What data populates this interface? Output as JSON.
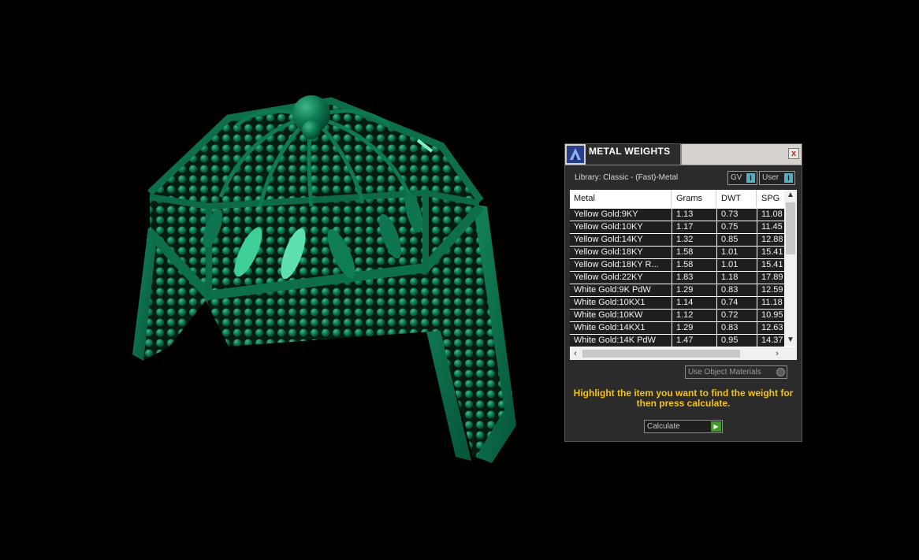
{
  "panel": {
    "title": "METAL WEIGHTS",
    "close": "x",
    "library": "Library: Classic - (Fast)-Metal",
    "gv_label": "GV",
    "user_label": "User",
    "gv_cap": "I",
    "user_cap": "I",
    "use_object_materials": "Use Object Materials",
    "hint": "Highlight the item you want to find the weight for then press calculate.",
    "calculate": "Calculate"
  },
  "table": {
    "columns": [
      "Metal",
      "Grams",
      "DWT",
      "SPG"
    ],
    "rows": [
      [
        "Yellow Gold:9KY",
        "1.13",
        "0.73",
        "11.08"
      ],
      [
        "Yellow Gold:10KY",
        "1.17",
        "0.75",
        "11.45"
      ],
      [
        "Yellow Gold:14KY",
        "1.32",
        "0.85",
        "12.88"
      ],
      [
        "Yellow Gold:18KY",
        "1.58",
        "1.01",
        "15.41"
      ],
      [
        "Yellow Gold:18KY R...",
        "1.58",
        "1.01",
        "15.41"
      ],
      [
        "Yellow Gold:22KY",
        "1.83",
        "1.18",
        "17.89"
      ],
      [
        "White Gold:9K PdW",
        "1.29",
        "0.83",
        "12.59"
      ],
      [
        "White Gold:10KX1",
        "1.14",
        "0.74",
        "11.18"
      ],
      [
        "White Gold:10KW",
        "1.12",
        "0.72",
        "10.95"
      ],
      [
        "White Gold:14KX1",
        "1.29",
        "0.83",
        "12.63"
      ],
      [
        "White Gold:14K PdW",
        "1.47",
        "0.95",
        "14.37"
      ]
    ]
  },
  "colors": {
    "model_green": "#0d6e4a",
    "highlight_green": "#4fdca8",
    "hint_yellow": "#f2c21c"
  }
}
